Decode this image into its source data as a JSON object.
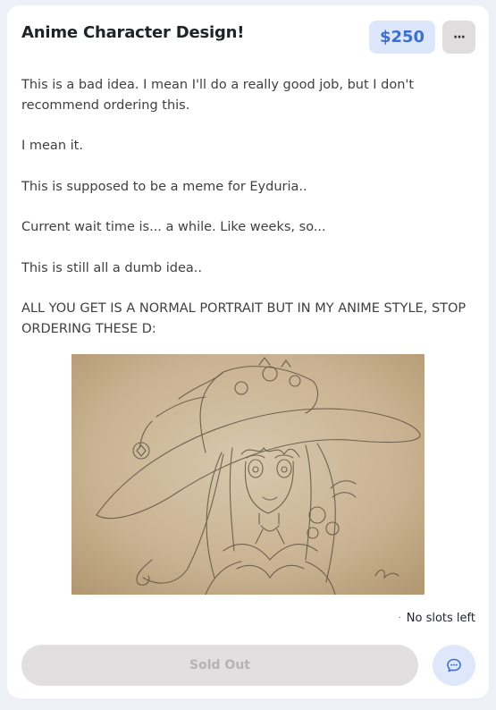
{
  "listing": {
    "title": "Anime Character Design!",
    "price": "$250",
    "more_label": "···",
    "description": [
      "This is a bad idea. I mean I'll do a really good job, but I don't recommend ordering this.",
      "I mean it.",
      "This is supposed to be a meme for Eyduria..",
      "Current wait time is... a while. Like weeks, so...",
      "This is still all a dumb idea..",
      "ALL YOU GET IS A NORMAL PORTRAIT BUT IN MY ANIME STYLE, STOP ORDERING THESE D:"
    ],
    "slots_status": "No slots left",
    "slots_dot": "·",
    "sold_out_label": "Sold Out"
  },
  "colors": {
    "price_bg": "#dde7fb",
    "price_text": "#3d6ed0",
    "sold_out_bg": "#e3dedf",
    "chat_bg": "#dfe7fb"
  },
  "icons": {
    "more": "more-horizontal-icon",
    "chat": "chat-bubble-icon"
  }
}
